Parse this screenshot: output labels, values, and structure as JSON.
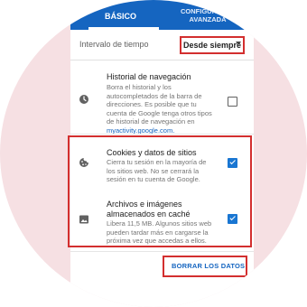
{
  "tabs": [
    {
      "label": "BÁSICO"
    },
    {
      "label": "CONFIGURACIÓN AVANZADA"
    }
  ],
  "interval": {
    "label": "Intervalo de tiempo",
    "value": "Desde siempre"
  },
  "items": [
    {
      "title": "Historial de navegación",
      "description": "Borra el historial y los autocompletados de la barra de direcciones. Es posible que tu cuenta de Google tenga otros tipos de historial de navegación en",
      "link": "myactivity.google.com.",
      "checked": false,
      "icon": "clock-icon"
    },
    {
      "title": "Cookies y datos de sitios",
      "description": "Cierra tu sesión en la mayoría de los sitios web. No se cerrará la sesión en tu cuenta de Google.",
      "checked": true,
      "icon": "cookie-icon"
    },
    {
      "title": "Archivos e imágenes almacenados en caché",
      "description": "Libera 11,5 MB. Algunos sitios web pueden tardar más en cargarse la próxima vez que accedas a ellos.",
      "checked": true,
      "icon": "image-icon"
    }
  ],
  "clear_button": {
    "label": "BORRAR LOS DATOS"
  },
  "colors": {
    "accent": "#1565c0",
    "highlight": "#d32f2f",
    "background_circle": "#f6e0e3"
  }
}
